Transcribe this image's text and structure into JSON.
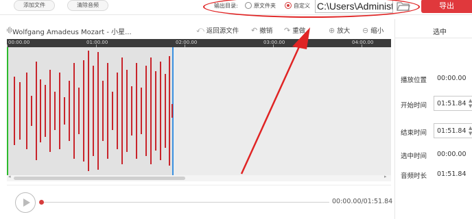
{
  "toolbar": {
    "add_file": "添加文件",
    "clear_audio": "清除音频",
    "output_dir_label": "输出目录:",
    "option_original": "原文件夹",
    "option_custom": "自定义",
    "path_value": "C:\\Users\\Administ",
    "export": "导出"
  },
  "editor": {
    "file_title": "Wolfgang Amadeus Mozart - 小星...",
    "restore": "返回源文件",
    "undo": "撤销",
    "redo": "重做",
    "zoom_in": "放大",
    "zoom_out": "缩小"
  },
  "timeline": {
    "ticks": [
      "00:00.00",
      "01:00.00",
      "02:00.00",
      "03:00.00",
      "04:00.00"
    ]
  },
  "player": {
    "time": "00:00.00/01:51.84",
    "progress": 0
  },
  "side": {
    "header": "选中",
    "play_position_label": "播放位置",
    "play_position_value": "00:00.00",
    "start_label": "开始时间",
    "start_value": "01:51.84",
    "end_label": "结束时间",
    "end_value": "01:51.84",
    "selected_label": "选中时间",
    "selected_value": "00:00.00",
    "duration_label": "音频时长",
    "duration_value": "01:51.84"
  },
  "colors": {
    "accent": "#e0383c",
    "waveform": "#c8232a",
    "start_marker": "#2dbb2d",
    "end_marker": "#3a90e0",
    "annotation": "#e02424"
  },
  "icons": [
    "folder-icon",
    "waveform-icon",
    "restore-icon",
    "undo-icon",
    "redo-icon",
    "zoom-in-icon",
    "zoom-out-icon",
    "play-icon",
    "spin-icon"
  ]
}
